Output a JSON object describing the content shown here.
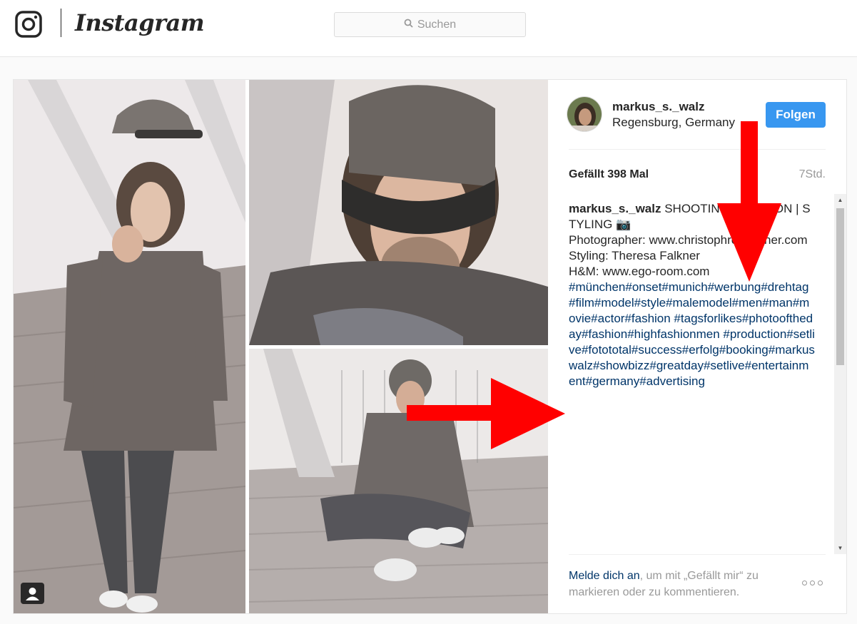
{
  "header": {
    "brand": "Instagram",
    "search_placeholder": "Suchen"
  },
  "post": {
    "username": "markus_s._walz",
    "location": "Regensburg, Germany",
    "follow_label": "Folgen",
    "likes": "Gefällt 398 Mal",
    "time_ago": "7Std.",
    "caption": {
      "user": "markus_s._walz",
      "lines": [
        "SHOOTING | FASHION | STYLING 📷",
        "Photographer: www.christophrehbacher.com",
        "Styling: Theresa Falkner",
        "H&M: www.ego-room.com"
      ],
      "hashtags": "#münchen#onset#munich#werbung#drehtag#film#model#style#malemodel#men#man#movie#actor#fashion #tagsforlikes#photooftheday#fashion#highfashionmen #production#setlive#fotototal#success#erfolg#booking#markuswalz#showbizz#greatday#setlive#entertainment#germany#advertising"
    },
    "footer": {
      "login_link": "Melde dich an",
      "login_rest": ", um mit „Gefällt mir“ zu markieren oder zu kommentieren."
    }
  },
  "colors": {
    "follow_button": "#3897f0",
    "hashtag_link": "#003569",
    "annotation_arrow": "#ff0000"
  },
  "icons": [
    "instagram-glyph-icon",
    "search-icon",
    "user-tag-icon",
    "more-options-icon"
  ]
}
